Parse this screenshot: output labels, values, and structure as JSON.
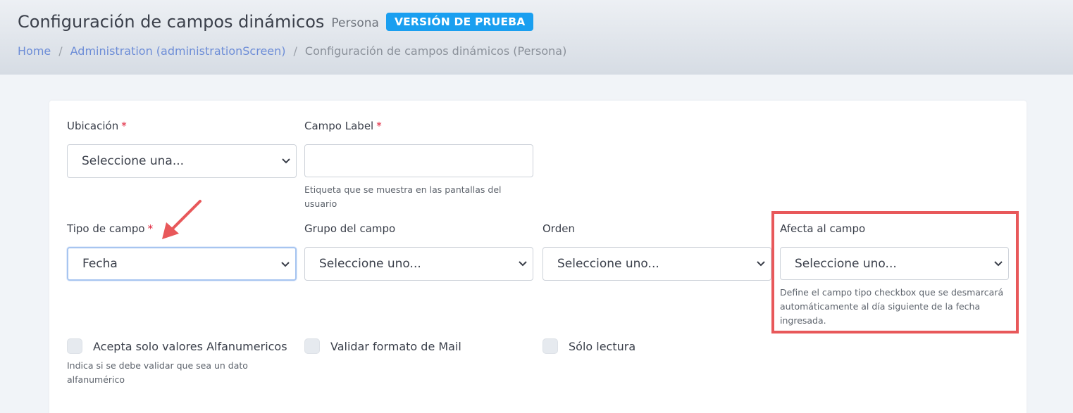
{
  "header": {
    "title": "Configuración de campos dinámicos",
    "subtitle": "Persona",
    "badge": "VERSIÓN DE PRUEBA",
    "breadcrumb": [
      "Home",
      "Administration (administrationScreen)",
      "Configuración de campos dinámicos (Persona)"
    ],
    "separator": "/"
  },
  "form": {
    "ubicacion": {
      "label": "Ubicación",
      "required": "*",
      "value": "Seleccione una..."
    },
    "campo_label": {
      "label": "Campo Label",
      "required": "*",
      "value": "",
      "help": "Etiqueta que se muestra en las pantallas del usuario"
    },
    "tipo_campo": {
      "label": "Tipo de campo",
      "required": "*",
      "value": "Fecha"
    },
    "grupo_campo": {
      "label": "Grupo del campo",
      "value": "Seleccione uno..."
    },
    "orden": {
      "label": "Orden",
      "value": "Seleccione uno..."
    },
    "afecta_campo": {
      "label": "Afecta al campo",
      "value": "Seleccione uno...",
      "help": "Define el campo tipo checkbox que se desmarcará automáticamente al día siguiente de la fecha ingresada."
    },
    "checkboxes": [
      {
        "label": "Acepta solo valores Alfanumericos",
        "checked": false,
        "help": "Indica si se debe validar que sea un dato alfanumérico"
      },
      {
        "label": "Validar formato de Mail",
        "checked": false
      },
      {
        "label": "Sólo lectura",
        "checked": false
      }
    ]
  },
  "colors": {
    "badge": "#1a9ff0",
    "link": "#6d8dd7",
    "required": "#e0223a",
    "annotation": "#e8585a"
  },
  "icons": [
    "chevron-down-icon",
    "annotation-arrow-icon"
  ]
}
